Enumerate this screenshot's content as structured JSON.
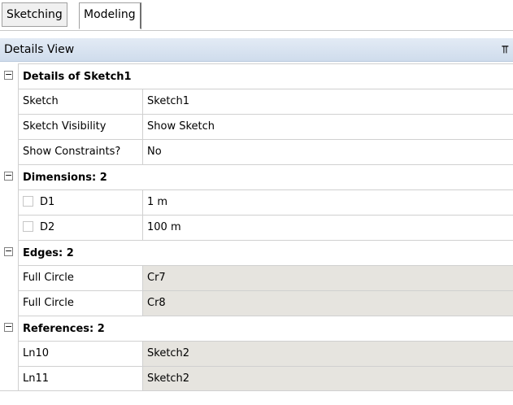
{
  "tabs": [
    {
      "label": "Sketching"
    },
    {
      "label": "Modeling"
    }
  ],
  "header": {
    "title": "Details View",
    "pin_glyph": "q"
  },
  "expand_glyph": "−",
  "groups": [
    {
      "title": "Details of Sketch1",
      "rows": [
        {
          "name": "Sketch",
          "value": "Sketch1"
        },
        {
          "name": "Sketch Visibility",
          "value": "Show Sketch"
        },
        {
          "name": "Show Constraints?",
          "value": "No"
        }
      ]
    },
    {
      "title": "Dimensions: 2",
      "rows": [
        {
          "name": "D1",
          "value": "1 m"
        },
        {
          "name": "D2",
          "value": "100 m"
        }
      ]
    },
    {
      "title": "Edges: 2",
      "rows": [
        {
          "name": "Full Circle",
          "value": "Cr7"
        },
        {
          "name": "Full Circle",
          "value": "Cr8"
        }
      ]
    },
    {
      "title": "References: 2",
      "rows": [
        {
          "name": "Ln10",
          "value": "Sketch2"
        },
        {
          "name": "Ln11",
          "value": "Sketch2"
        }
      ]
    }
  ],
  "colors": {
    "readonly_bg": "#e6e4df",
    "header_bg": "#dbe5f1"
  }
}
